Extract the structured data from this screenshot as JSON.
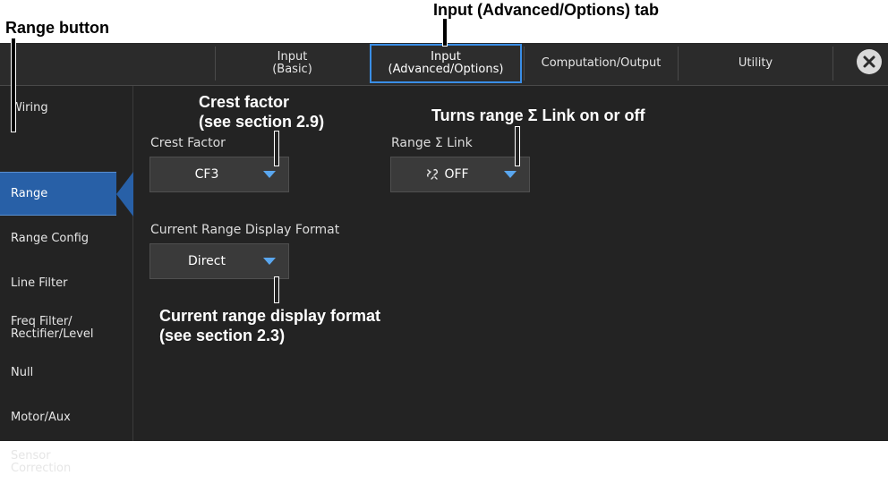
{
  "annotations": {
    "range_button": "Range button",
    "adv_tab": "Input (Advanced/Options) tab",
    "crest_factor": "Crest factor\n(see section 2.9)",
    "sigma_link": "Turns range Σ Link on or off",
    "display_format": "Current range display format\n(see section 2.3)"
  },
  "tabs": [
    {
      "label": "Input\n(Basic)"
    },
    {
      "label": "Input\n(Advanced/Options)",
      "active": true
    },
    {
      "label": "Computation/Output"
    },
    {
      "label": "Utility"
    }
  ],
  "close_icon": "close-icon",
  "sidebar": {
    "items": [
      {
        "label": "Wiring"
      },
      {
        "label": "Range",
        "active": true
      },
      {
        "label": "Range Config"
      },
      {
        "label": "Line Filter"
      },
      {
        "label": "Freq Filter/\nRectifier/Level"
      },
      {
        "label": "Null"
      },
      {
        "label": "Motor/Aux"
      },
      {
        "label": "Sensor\nCorrection"
      }
    ]
  },
  "main": {
    "crest_factor": {
      "label": "Crest Factor",
      "value": "CF3"
    },
    "sigma_link": {
      "label": "Range Σ Link",
      "value": "OFF",
      "icon": "unlink-icon"
    },
    "display_format": {
      "label": "Current Range Display Format",
      "value": "Direct"
    }
  },
  "colors": {
    "accent": "#2860a7",
    "tab_highlight": "#3a8ee6",
    "caret": "#5aa7ef",
    "background": "#232323"
  }
}
